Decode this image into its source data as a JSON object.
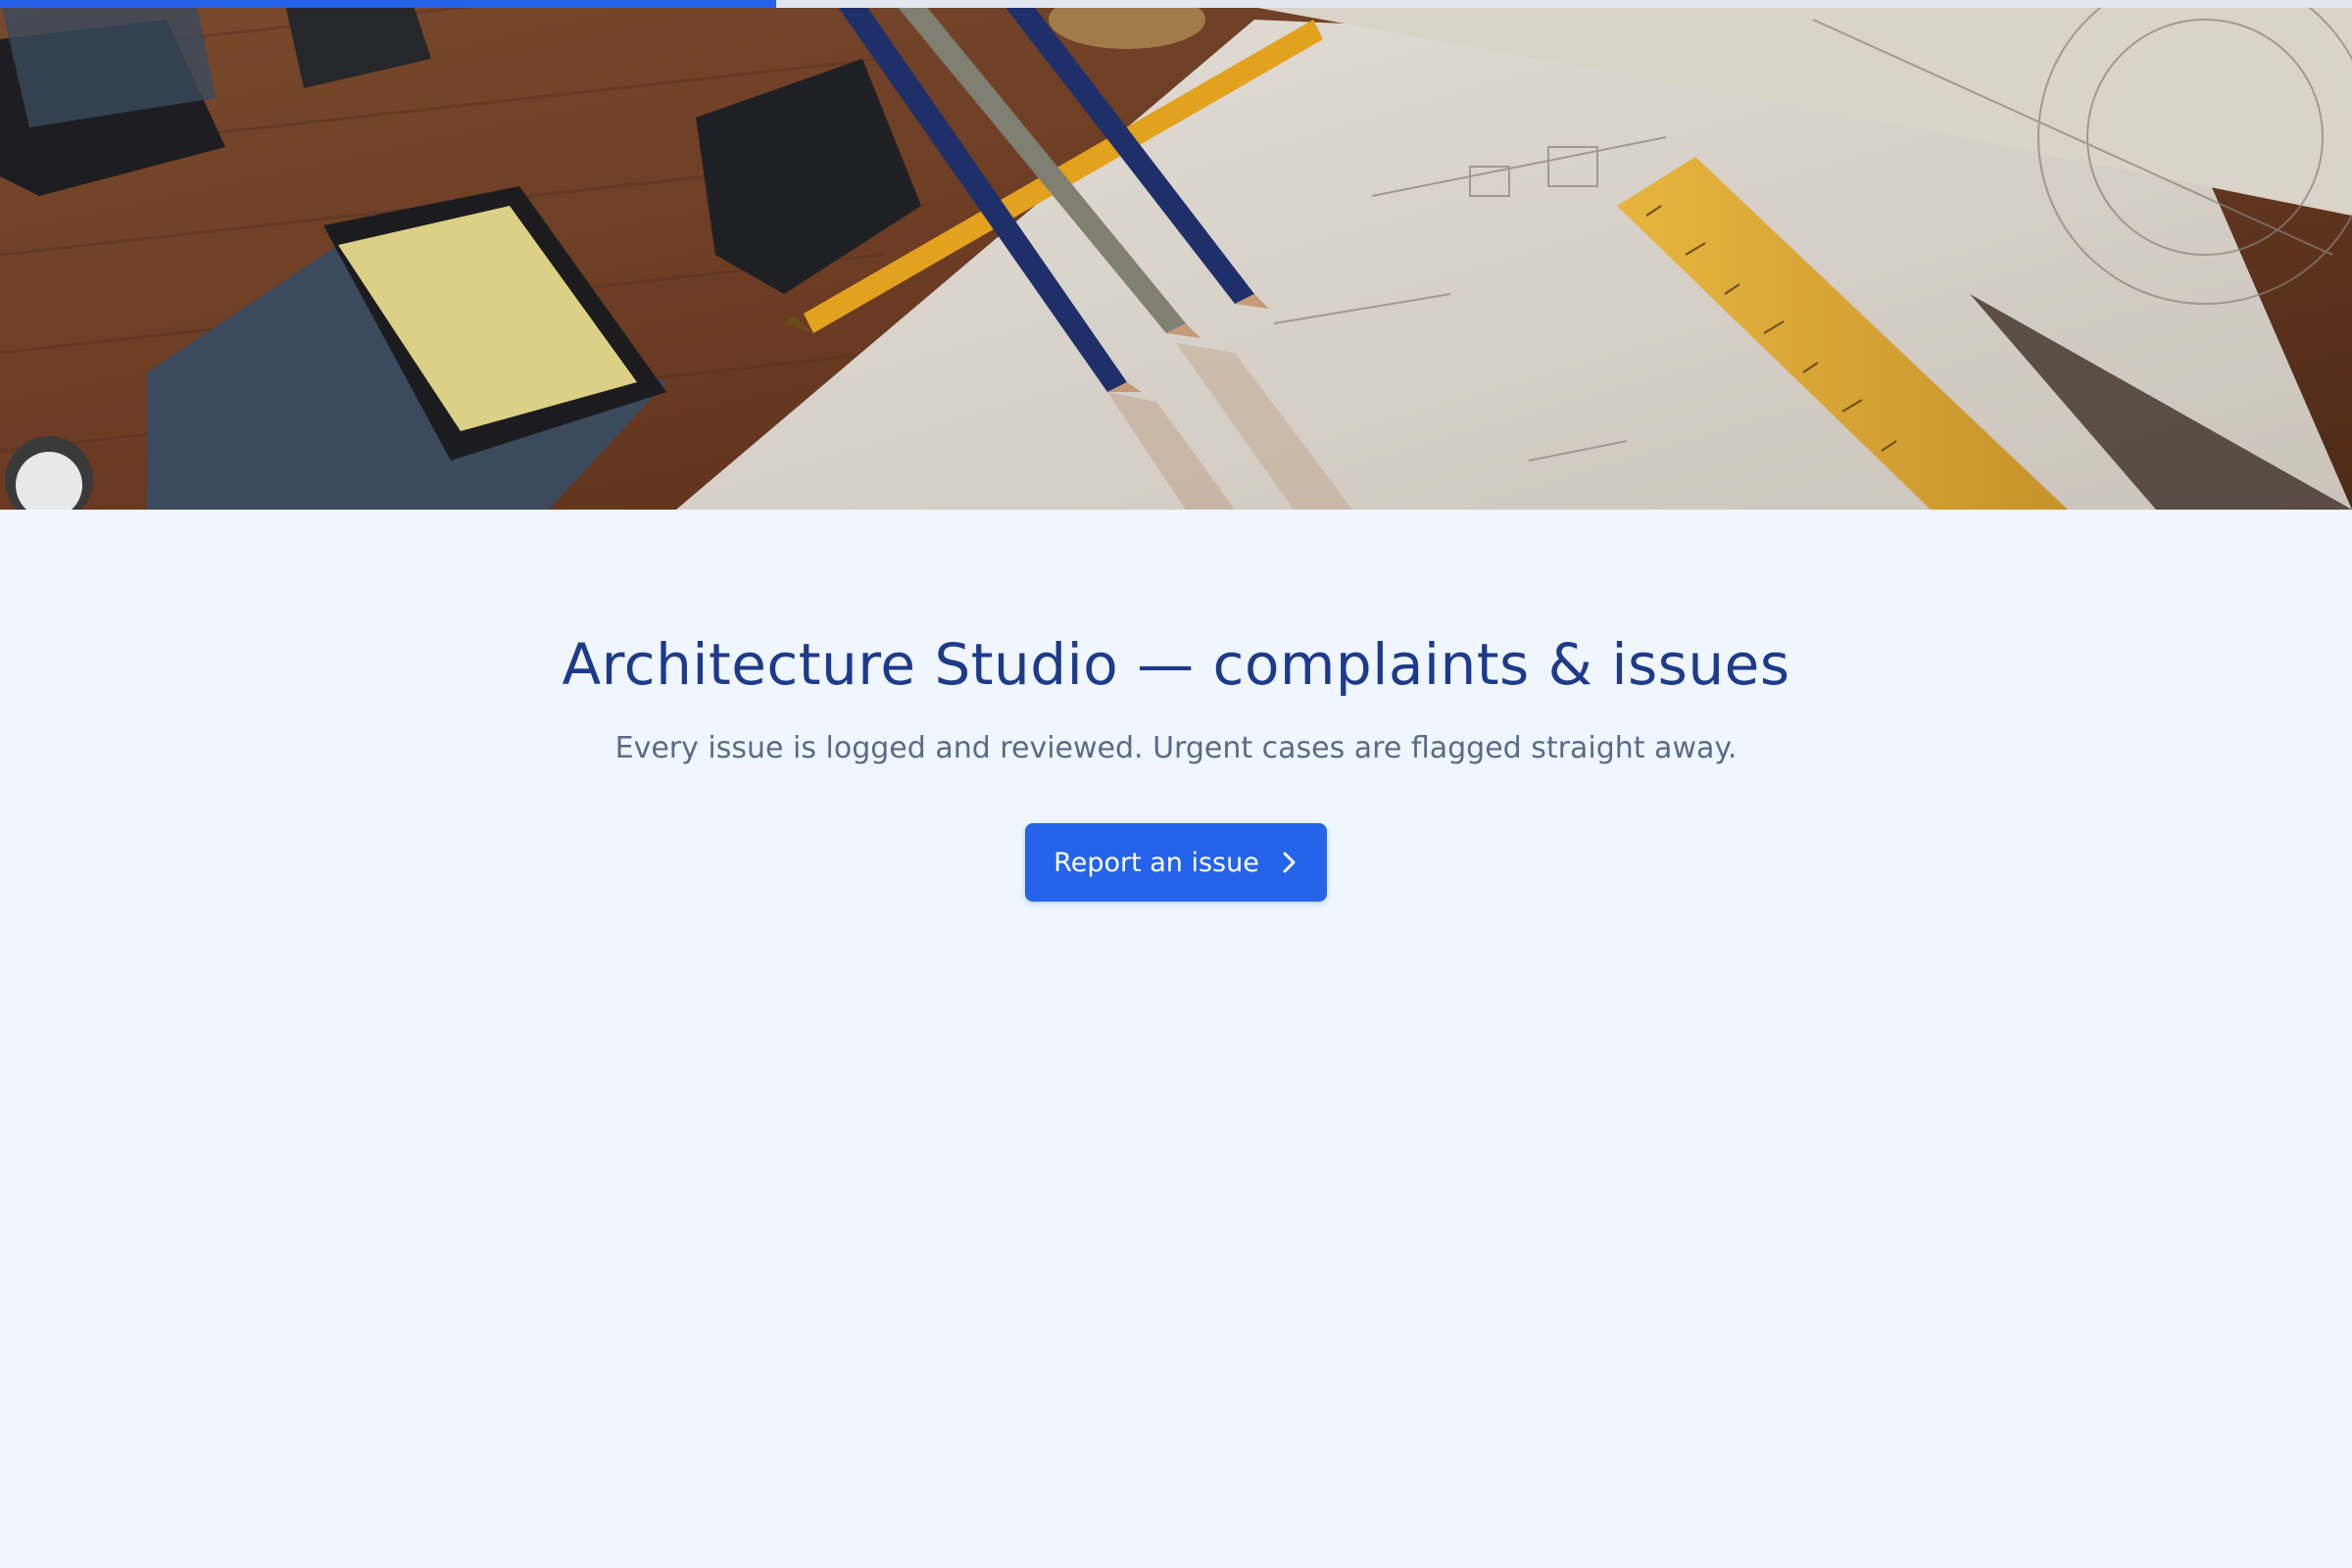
{
  "progress": {
    "fraction": 0.33,
    "color": "#2563eb"
  },
  "hero": {
    "image": "architecture-desk-photo"
  },
  "main": {
    "title": "Architecture Studio — complaints & issues",
    "subtitle": "Every issue is logged and reviewed. Urgent cases are flagged straight away.",
    "cta": {
      "label": "Report an issue",
      "icon": "chevron-right-icon"
    }
  },
  "colors": {
    "background": "#eff6fe",
    "title": "#1e3a8a",
    "subtitle": "#5b6b86",
    "accent": "#2563eb"
  }
}
